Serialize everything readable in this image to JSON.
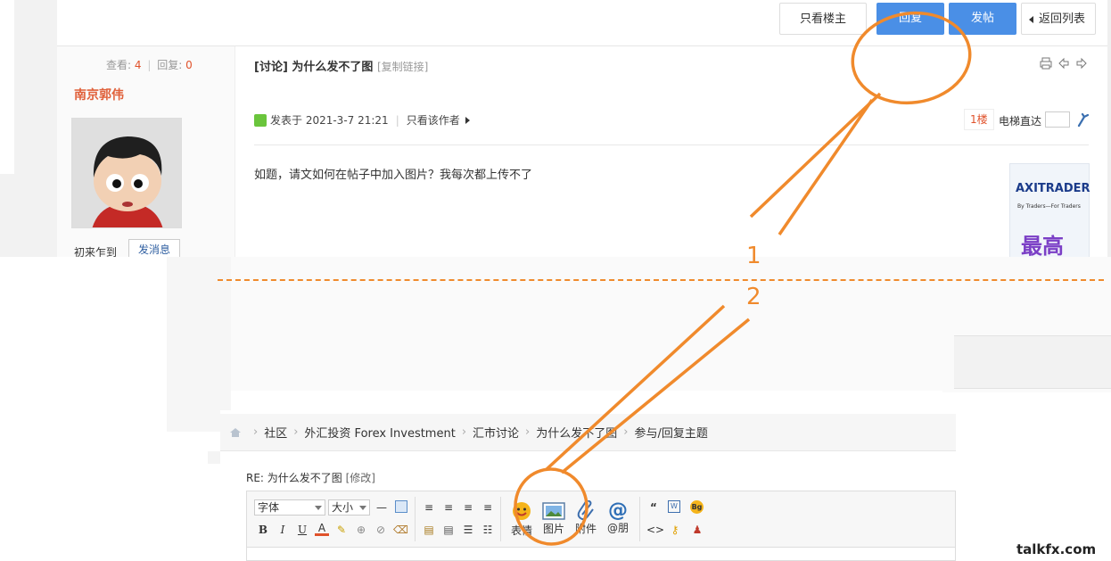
{
  "top_post": {
    "buttons": {
      "only_op": "只看楼主",
      "reply": "回复",
      "new_post": "发帖",
      "back": "返回列表"
    },
    "stats": {
      "views_label": "查看:",
      "views": "4",
      "replies_label": "回复:",
      "replies": "0"
    },
    "author": {
      "name": "南京郭伟",
      "signature": "初来乍到",
      "message_button": "发消息"
    },
    "title": "[讨论] 为什么发不了图",
    "copy_link": "[复制链接]",
    "meta": {
      "posted": "发表于 2021-3-7 21:21",
      "author_only": "只看该作者"
    },
    "floor": "1楼",
    "jump_label": "电梯直达",
    "body": "如题，请文如何在帖子中加入图片？我每次都上传不了",
    "ad": {
      "brand": "AXITRADER",
      "tagline": "By Traders—For Traders",
      "big_text": "最高"
    }
  },
  "annotations": {
    "step1": "1",
    "step2": "2",
    "accent": "#f08a2c"
  },
  "editor": {
    "breadcrumb": [
      "社区",
      "外汇投资 Forex Investment",
      "汇市讨论",
      "为什么发不了图",
      "参与/回复主题"
    ],
    "reply_title": "RE: 为什么发不了图",
    "reply_edit": "[修改]",
    "font_select": "字体",
    "size_select": "大小",
    "emoji_label": "表情",
    "image_label": "图片",
    "attach_label": "附件",
    "mention_label": "@朋"
  },
  "watermark": "talkfx.com",
  "colors": {
    "primary_blue": "#4a8fe6",
    "accent_orange": "#f08a2c",
    "count_red": "#e0522b"
  }
}
